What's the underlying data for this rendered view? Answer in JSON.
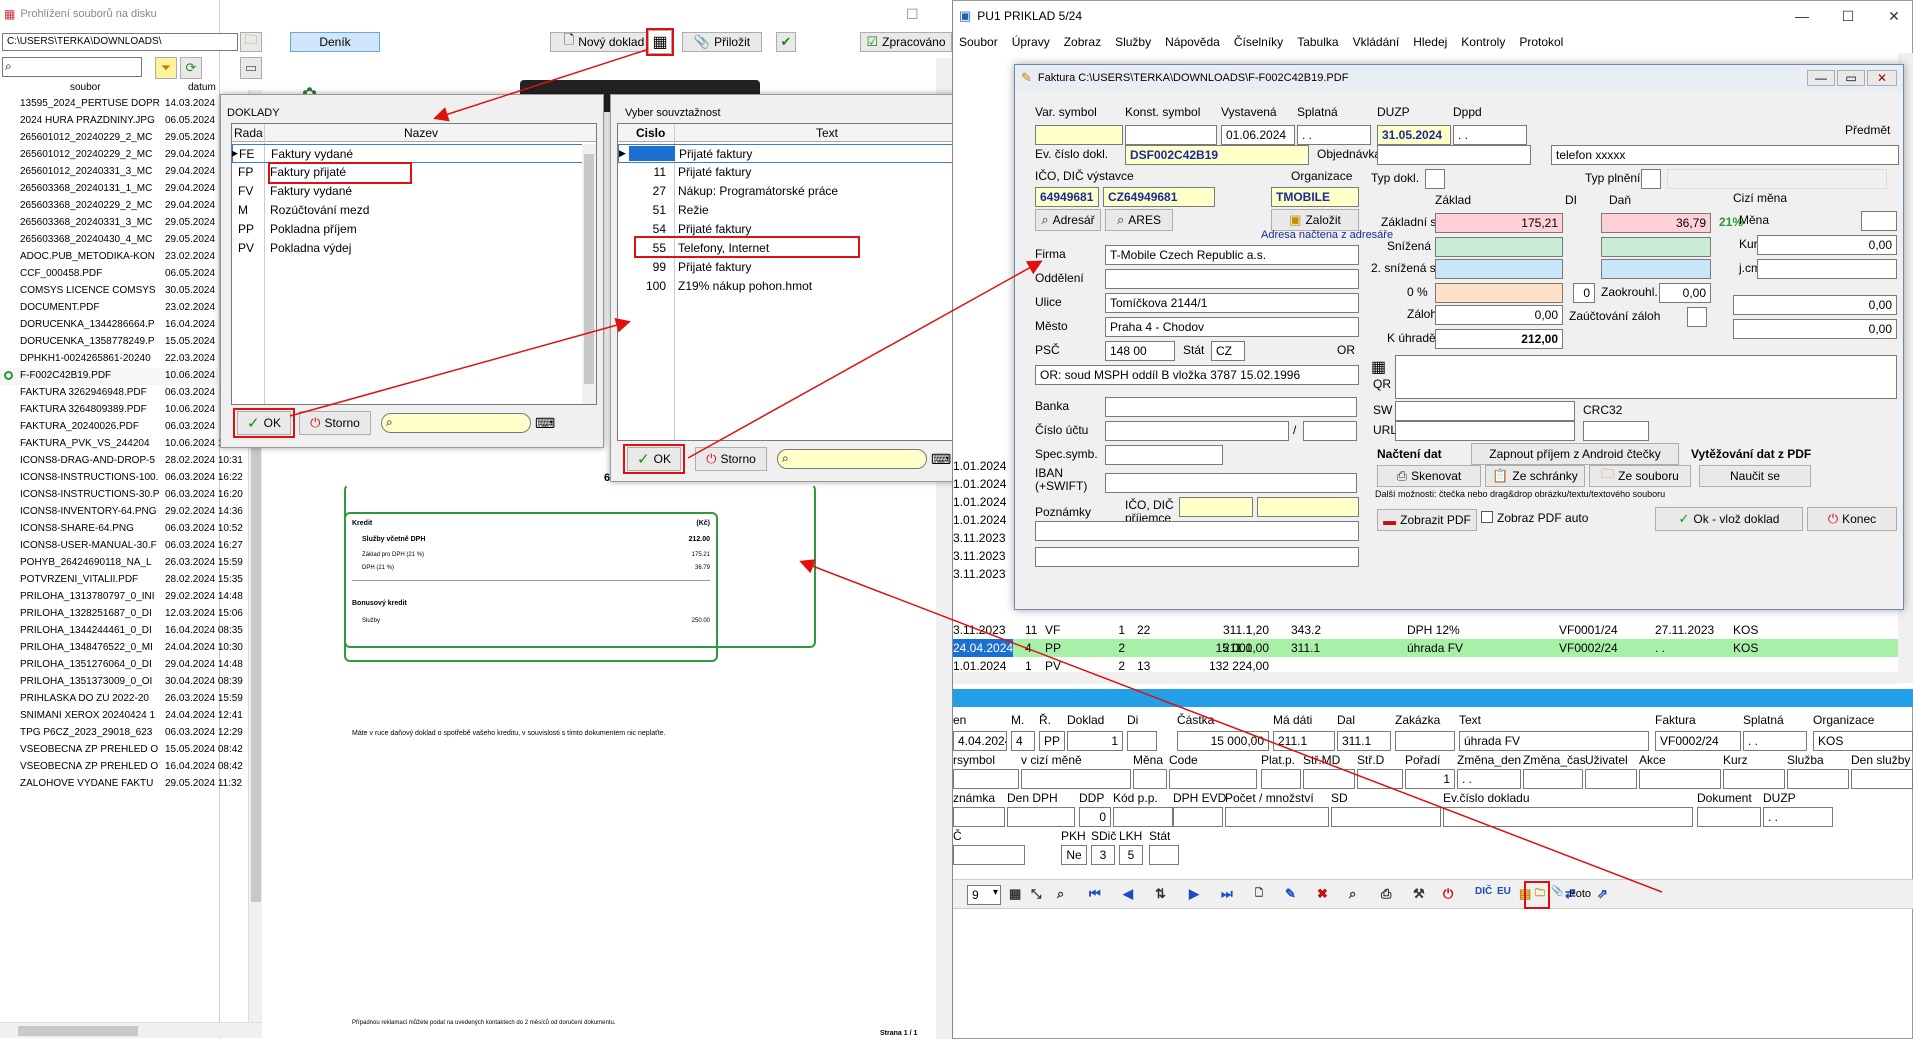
{
  "left_window": {
    "title": "Prohlížení souborů na disku",
    "path": "C:\\USERS\\TERKA\\DOWNLOADS\\",
    "col_soubor": "soubor",
    "col_datum": "datum",
    "files": [
      {
        "name": "13595_2024_PERTUSE DOPR",
        "date": "14.03.2024"
      },
      {
        "name": "2024 HURÁ PRÁZDNINY.JPG",
        "date": "06.05.2024"
      },
      {
        "name": "265601012_20240229_2_MC",
        "date": "29.05.2024"
      },
      {
        "name": "265601012_20240229_2_MC",
        "date": "29.04.2024"
      },
      {
        "name": "265601012_20240331_3_MC",
        "date": "29.04.2024"
      },
      {
        "name": "265603368_20240131_1_MC",
        "date": "29.04.2024"
      },
      {
        "name": "265603368_20240229_2_MC",
        "date": "29.04.2024"
      },
      {
        "name": "265603368_20240331_3_MC",
        "date": "29.05.2024"
      },
      {
        "name": "265603368_20240430_4_MC",
        "date": "29.05.2024"
      },
      {
        "name": "ADOC.PUB_METODIKA-KON",
        "date": "23.02.2024"
      },
      {
        "name": "CCF_000458.PDF",
        "date": "06.05.2024"
      },
      {
        "name": "COMSYS LICENCE COMSYS",
        "date": "30.05.2024"
      },
      {
        "name": "DOCUMENT.PDF",
        "date": "23.02.2024"
      },
      {
        "name": "DORUCENKA_1344286664.P",
        "date": "16.04.2024"
      },
      {
        "name": "DORUCENKA_1358778249.P",
        "date": "15.05.2024"
      },
      {
        "name": "DPHKH1-0024265861-20240",
        "date": "22.03.2024"
      },
      {
        "name": "F-F002C42B19.PDF",
        "date": "10.06.2024",
        "selected": true
      },
      {
        "name": "FAKTURA 3262946948.PDF",
        "date": "06.03.2024"
      },
      {
        "name": "FAKTURA 3264809389.PDF",
        "date": "10.06.2024"
      },
      {
        "name": "FAKTURA_20240026.PDF",
        "date": "06.03.2024"
      },
      {
        "name": "FAKTURA_PVK_VS_244204",
        "date": "10.06.2024 13:00"
      },
      {
        "name": "ICONS8-DRAG-AND-DROP-5",
        "date": "28.02.2024 10:31"
      },
      {
        "name": "ICONS8-INSTRUCTIONS-100.",
        "date": "06.03.2024 16:22"
      },
      {
        "name": "ICONS8-INSTRUCTIONS-30.P",
        "date": "06.03.2024 16:20"
      },
      {
        "name": "ICONS8-INVENTORY-64.PNG",
        "date": "29.02.2024 14:36"
      },
      {
        "name": "ICONS8-SHARE-64.PNG",
        "date": "06.03.2024 10:52"
      },
      {
        "name": "ICONS8-USER-MANUAL-30.F",
        "date": "06.03.2024 16:27"
      },
      {
        "name": "POHYB_26424690118_NA_L",
        "date": "26.03.2024 15:59"
      },
      {
        "name": "POTVRZENI_VITALII.PDF",
        "date": "28.02.2024 15:35"
      },
      {
        "name": "PRILOHA_1313780797_0_INI",
        "date": "29.02.2024 14:48"
      },
      {
        "name": "PRILOHA_1328251687_0_DI",
        "date": "12.03.2024 15:06"
      },
      {
        "name": "PRILOHA_1344244461_0_DI",
        "date": "16.04.2024 08:35"
      },
      {
        "name": "PRILOHA_1348476522_0_MI",
        "date": "24.04.2024 10:30"
      },
      {
        "name": "PRILOHA_1351276064_0_DI",
        "date": "29.04.2024 14:48"
      },
      {
        "name": "PRILOHA_1351373009_0_OI",
        "date": "30.04.2024 08:39"
      },
      {
        "name": "PŘIHLÁŠKA DO ZÚ 2022-20",
        "date": "26.03.2024 15:59"
      },
      {
        "name": "SNÍMÁNÍ XEROX 20240424 1",
        "date": "24.04.2024 12:41"
      },
      {
        "name": "TPG P6CZ_2023_29018_623",
        "date": "06.03.2024 12:29"
      },
      {
        "name": "VŠEOBECNÁ ZP PŘEHLED O",
        "date": "15.05.2024 08:42"
      },
      {
        "name": "VŠEOBECNÁ ZP PŘEHLED O",
        "date": "16.04.2024 08:42"
      },
      {
        "name": "ZÁLOHOVÉ VYDANÉ FAKTU",
        "date": "29.05.2024 11:32"
      }
    ]
  },
  "viewer_toolbar": {
    "denik": "Deník",
    "novy_doklad": "Nový doklad",
    "prilozit": "Přiložit",
    "zpracovano": "Zpracováno"
  },
  "pdf": {
    "kredit": "Kredit",
    "kc": "(Kč)",
    "sluzby_dph": "Služby včetně DPH",
    "sluzby_dph_val": "212.00",
    "zaklad": "Základ pro DPH (21 %)",
    "zaklad_val": "175.21",
    "dph": "DPH (21 %)",
    "dph_val": "36.79",
    "bonus": "Bonusový kredit",
    "sluzby": "Služby",
    "sluzby_val": "250.00",
    "note": "Máte v ruce daňový doklad o spotřebě vašeho kreditu, v souvislosti s tímto dokumentem nic neplaťte.",
    "footer": "Případnou reklamaci můžete podat na uvedených kontaktech do 2 měsíců od doručení dokumentu.",
    "page": "Strana 1 / 1",
    "partial": "6"
  },
  "doklady": {
    "title": "DOKLADY",
    "col_rada": "Rada",
    "col_nazev": "Nazev",
    "rows": [
      {
        "code": "FE",
        "name": "Faktury vydané"
      },
      {
        "code": "FP",
        "name": "Faktury přijaté"
      },
      {
        "code": "FV",
        "name": "Faktury vydané"
      },
      {
        "code": "M",
        "name": "Rozúčtování mezd"
      },
      {
        "code": "PP",
        "name": "Pokladna příjem"
      },
      {
        "code": "PV",
        "name": "Pokladna výdej"
      }
    ],
    "ok": "OK",
    "storno": "Storno"
  },
  "souvztaznost": {
    "title": "Vyber souvztažnost",
    "col_cislo": "Cislo",
    "col_text": "Text",
    "rows": [
      {
        "num": "",
        "text": "Přijaté faktury"
      },
      {
        "num": "11",
        "text": "Přijaté faktury"
      },
      {
        "num": "27",
        "text": "Nákup: Programátorské práce"
      },
      {
        "num": "51",
        "text": "Režie"
      },
      {
        "num": "54",
        "text": "Přijaté faktury"
      },
      {
        "num": "55",
        "text": "Telefony, Internet"
      },
      {
        "num": "99",
        "text": "Přijaté faktury"
      },
      {
        "num": "100",
        "text": "Z19% nákup pohon.hmot"
      }
    ],
    "ok": "OK",
    "storno": "Storno"
  },
  "pu1": {
    "title": "PU1 PRIKLAD 5/24",
    "menu": [
      "Soubor",
      "Úpravy",
      "Zobraz",
      "Služby",
      "Nápověda",
      "Číselníky",
      "Tabulka",
      "Vkládání",
      "Hledej",
      "Kontroly",
      "Protokol"
    ]
  },
  "faktura": {
    "title": "Faktura C:\\USERS\\TERKA\\DOWNLOADS\\F-F002C42B19.PDF",
    "var_symbol_lbl": "Var. symbol",
    "konst_symbol_lbl": "Konst. symbol",
    "vystavena_lbl": "Vystavená",
    "vystavena": "01.06.2024",
    "splatna_lbl": "Splatná",
    "splatna": ". .",
    "duzp_lbl": "DUZP",
    "duzp": "31.05.2024",
    "dppd_lbl": "Dppd",
    "dppd": ". .",
    "predmet_lbl": "Předmět",
    "predmet": "telefon xxxxx",
    "ev_cislo_lbl": "Ev. číslo dokl.",
    "ev_cislo": "DSF002C42B19",
    "objednavka_lbl": "Objednávka",
    "ico_dic_lbl": "IČO, DIČ výstavce",
    "organizace_lbl": "Organizace",
    "ico": "64949681",
    "dic": "CZ64949681",
    "organizace": "TMOBILE",
    "adresar": "Adresář",
    "ares": "ARES",
    "zalozit": "Založit",
    "adresa_note": "Adresa načtena z adresáře",
    "firma_lbl": "Firma",
    "firma": "T-Mobile Czech Republic a.s.",
    "oddeleni_lbl": "Oddělení",
    "ulice_lbl": "Ulice",
    "ulice": "Tomíčkova 2144/1",
    "mesto_lbl": "Město",
    "mesto": "Praha 4 - Chodov",
    "psc_lbl": "PSČ",
    "psc": "148 00",
    "stat_lbl": "Stát",
    "stat": "CZ",
    "or_lbl": "OR",
    "or_text": "OR: soud MSPH oddíl B vložka 3787 15.02.1996",
    "banka_lbl": "Banka",
    "cislo_uctu_lbl": "Číslo účtu",
    "spec_symb_lbl": "Spec.symb.",
    "iban_lbl": "IBAN (+SWIFT)",
    "poznamky_lbl": "Poznámky",
    "ico_prijemce_lbl": "IČO, DIČ příjemce",
    "typ_dokl_lbl": "Typ dokl.",
    "typ_plneni_lbl": "Typ plnění",
    "zaklad_lbl": "Základ",
    "di_lbl": "DI",
    "dan_lbl": "Daň",
    "cizi_mena_lbl": "Cizí měna",
    "zakladni_s_lbl": "Základní s.",
    "zakladni_zaklad": "175,21",
    "zakladni_dan": "36,79",
    "pct": "21%",
    "snizena_s_lbl": "Snížená s.",
    "snizena2_lbl": "2. snížená s.",
    "zero_lbl": "0 %",
    "zero_di": "0",
    "zaokrouhl_lbl": "Zaokrouhl.",
    "zaokrouhl": "0,00",
    "zalohy_lbl": "Zálohy",
    "zalohy": "0,00",
    "zauct_lbl": "Zaúčtování záloh",
    "k_uhrade_lbl": "K úhradě",
    "k_uhrade": "212,00",
    "mena_lbl": "Měna",
    "kurz_lbl": "Kurz",
    "kurz": "0,00",
    "jcm_lbl": "j.cm",
    "cm1": "0,00",
    "cm2": "0,00",
    "qr_lbl": "QR",
    "sw_lbl": "SW",
    "url_lbl": "URL",
    "crc_lbl": "CRC32",
    "nacteni_lbl": "Načtení dat",
    "android": "Zapnout příjem z Android čtečky",
    "vytezovani_lbl": "Vytěžování dat z PDF",
    "skenovat": "Skenovat",
    "ze_schranky": "Ze schránky",
    "ze_souboru": "Ze souboru",
    "naucit": "Naučit se",
    "dalsi": "Další možnosti: čtečka nebo drag&drop obrázku/textu/textového souboru",
    "zobrazit_pdf": "Zobrazit PDF",
    "zobraz_auto": "Zobraz PDF auto",
    "ok_vloz": "Ok - vlož doklad",
    "konec": "Konec"
  },
  "grid_left": {
    "dates": [
      "1.01.2024",
      "1.01.2024",
      "1.01.2024",
      "1.01.2024",
      "3.11.2023",
      "3.11.2023",
      "3.11.2023"
    ]
  },
  "grid_rows": [
    {
      "d": "3.11.2023",
      "m": "11",
      "r": "VF",
      "dk": "1",
      "di": "22",
      "c": "1,20",
      "md": "311.1",
      "dal": "343.2",
      "text": "DPH 12%",
      "fak": "VF0001/24",
      "spl": "27.11.2023",
      "org": "KOS"
    },
    {
      "d": "24.04.2024",
      "m": "4",
      "r": "PP",
      "dk": "2",
      "di": "",
      "c": "15 000,00",
      "md": "211.1",
      "dal": "311.1",
      "text": "úhrada FV",
      "fak": "VF0002/24",
      "spl": ". .",
      "org": "KOS",
      "hl": true
    },
    {
      "d": "1.01.2024",
      "m": "1",
      "r": "PV",
      "dk": "2",
      "di": "13",
      "c": "132 224,00",
      "md": "",
      "dal": "",
      "text": "",
      "fak": "",
      "spl": "",
      "org": ""
    }
  ],
  "detail": {
    "h1": [
      "en",
      "M.",
      "Ř.",
      "Doklad",
      "Di",
      "Částka",
      "Má dáti",
      "Dal",
      "Zakázka",
      "Text",
      "Faktura",
      "Splatná",
      "Organizace"
    ],
    "v1": [
      "4.04.2024",
      "4",
      "PP",
      "1",
      "",
      "15 000,00",
      "211.1",
      "311.1",
      "",
      "úhrada FV",
      "VF0002/24",
      ". .",
      "KOS"
    ],
    "h2": [
      "rsymbol",
      "v cizí měně",
      "Měna",
      "Code",
      "Plat.p.",
      "Stř.MD",
      "Stř.D",
      "Pořadí",
      "Změna_den",
      "Změna_čas",
      "Uživatel",
      "Akce",
      "Kurz",
      "Služba",
      "Den služby"
    ],
    "poradi": "1",
    "zmena_den": ". .",
    "h3": [
      "známka",
      "Den DPH",
      "DDP",
      "Kód p.p.",
      "DPH EVD",
      "Počet / množství",
      "SD",
      "Ev.číslo dokladu",
      "Dokument",
      "DUZP"
    ],
    "ddp": "0",
    "duzp3": ". .",
    "h4": [
      "Č",
      "PKH",
      "SDič",
      "LKH",
      "Stát"
    ],
    "pkh": "Ne",
    "sdic": "3",
    "lkh": "5",
    "page_num": "9",
    "foto": "Foto"
  }
}
